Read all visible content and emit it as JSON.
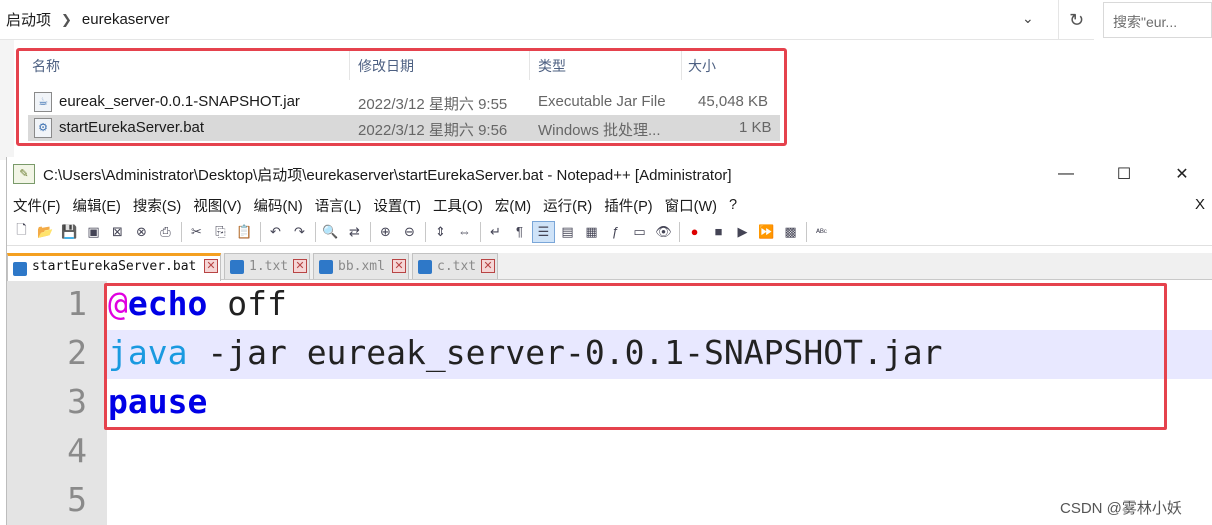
{
  "explorer": {
    "breadcrumb": [
      "启动项",
      "eurekaserver"
    ],
    "search_placeholder": "搜索\"eur...",
    "columns": [
      "名称",
      "修改日期",
      "类型",
      "大小"
    ],
    "files": [
      {
        "icon": "jar-file-icon",
        "name": "eureak_server-0.0.1-SNAPSHOT.jar",
        "modified": "2022/3/12 星期六 9:55",
        "type": "Executable Jar File",
        "size": "45,048 KB",
        "selected": false
      },
      {
        "icon": "bat-file-icon",
        "name": "startEurekaServer.bat",
        "modified": "2022/3/12 星期六 9:56",
        "type": "Windows 批处理...",
        "size": "1 KB",
        "selected": true
      }
    ]
  },
  "notepad": {
    "title": "C:\\Users\\Administrator\\Desktop\\启动项\\eurekaserver\\startEurekaServer.bat - Notepad++ [Administrator]",
    "menu": [
      "文件(F)",
      "编辑(E)",
      "搜索(S)",
      "视图(V)",
      "编码(N)",
      "语言(L)",
      "设置(T)",
      "工具(O)",
      "宏(M)",
      "运行(R)",
      "插件(P)",
      "窗口(W)",
      "?"
    ],
    "menu_close": "X",
    "tabs": [
      {
        "label": "startEurekaServer.bat",
        "active": true
      },
      {
        "label": "1.txt",
        "active": false
      },
      {
        "label": "bb.xml",
        "active": false
      },
      {
        "label": "c.txt",
        "active": false
      }
    ],
    "line_numbers": [
      "1",
      "2",
      "3",
      "4",
      "5"
    ],
    "code": {
      "line1_at": "@",
      "line1_kw": "echo",
      "line1_rest": " off",
      "line2_kw": "java",
      "line2_rest": " -jar eureak_server-0.0.1-SNAPSHOT.jar",
      "line3_kw": "pause"
    }
  },
  "watermark": "CSDN @雾林小妖",
  "colors": {
    "highlight_box": "#e5424d",
    "keyword": "#0000e6",
    "echo_at": "#e000e0",
    "java": "#1a9ae0"
  }
}
